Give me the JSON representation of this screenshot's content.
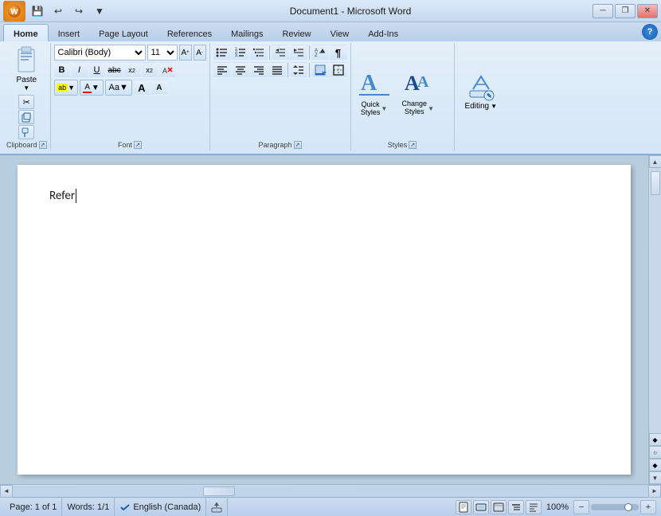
{
  "window": {
    "title": "Document1 - Microsoft Word"
  },
  "qat": {
    "save_label": "💾",
    "undo_label": "↩",
    "redo_label": "↪",
    "more_label": "▼"
  },
  "tabs": [
    {
      "id": "home",
      "label": "Home",
      "active": true
    },
    {
      "id": "insert",
      "label": "Insert",
      "active": false
    },
    {
      "id": "page-layout",
      "label": "Page Layout",
      "active": false
    },
    {
      "id": "references",
      "label": "References",
      "active": false
    },
    {
      "id": "mailings",
      "label": "Mailings",
      "active": false
    },
    {
      "id": "review",
      "label": "Review",
      "active": false
    },
    {
      "id": "view",
      "label": "View",
      "active": false
    },
    {
      "id": "add-ins",
      "label": "Add-Ins",
      "active": false
    }
  ],
  "ribbon": {
    "clipboard": {
      "label": "Clipboard",
      "paste_label": "Paste",
      "cut_label": "✂",
      "copy_label": "⬜",
      "format_painter_label": "🖌"
    },
    "font": {
      "label": "Font",
      "font_name": "Calibri (Body)",
      "font_size": "11",
      "bold": "B",
      "italic": "I",
      "underline": "U",
      "strikethrough": "abc",
      "subscript": "x₂",
      "superscript": "x²",
      "clear_format": "↺",
      "text_color": "A",
      "highlight_color": "ab",
      "font_color_label": "A",
      "change_case": "Aa",
      "grow": "A",
      "shrink": "A"
    },
    "paragraph": {
      "label": "Paragraph",
      "bullets": "≡•",
      "numbering": "≡1",
      "multilevel": "≡☰",
      "decrease_indent": "←≡",
      "increase_indent": "→≡",
      "sort": "↕A",
      "show_marks": "¶",
      "align_left": "≡",
      "align_center": "≡",
      "align_right": "≡",
      "justify": "≡",
      "line_spacing": "↕",
      "shading": "🔲",
      "borders": "⊞"
    },
    "styles": {
      "label": "Styles",
      "quick_styles_label": "Quick\nStyles",
      "change_styles_label": "Change\nStyles"
    },
    "editing": {
      "label": "Editing"
    }
  },
  "document": {
    "content": "Refer",
    "cursor_visible": true
  },
  "statusbar": {
    "page": "Page: 1 of 1",
    "words": "Words: 1/1",
    "language": "English (Canada)",
    "zoom": "100%"
  },
  "scrollbar": {
    "up_arrow": "▲",
    "down_arrow": "▼",
    "left_arrow": "◄",
    "right_arrow": "►"
  }
}
